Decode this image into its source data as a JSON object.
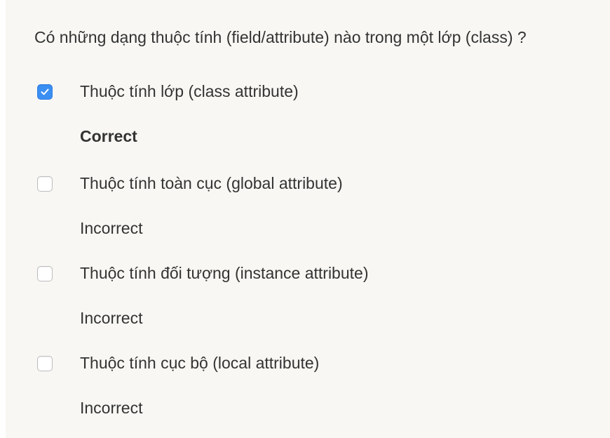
{
  "question": "Có những dạng thuộc tính (field/attribute) nào trong một lớp (class) ?",
  "options": [
    {
      "label": "Thuộc tính lớp (class attribute)",
      "checked": true,
      "feedback": "Correct"
    },
    {
      "label": "Thuộc tính toàn cục (global attribute)",
      "checked": false,
      "feedback": "Incorrect"
    },
    {
      "label": "Thuộc tính đối tượng (instance attribute)",
      "checked": false,
      "feedback": "Incorrect"
    },
    {
      "label": "Thuộc tính cục bộ (local attribute)",
      "checked": false,
      "feedback": "Incorrect"
    }
  ],
  "colors": {
    "background": "#f8f7f3",
    "checkbox_checked": "#3b8ff3",
    "text": "#333333"
  }
}
